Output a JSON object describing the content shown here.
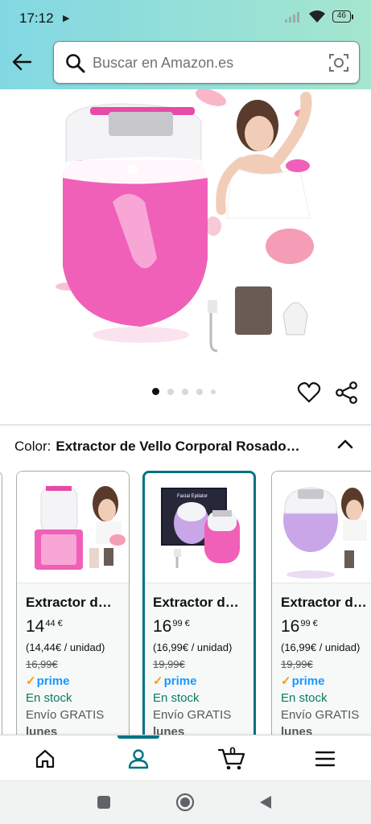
{
  "status_bar": {
    "time": "17:12",
    "battery": "46"
  },
  "search": {
    "placeholder": "Buscar en Amazon.es"
  },
  "gallery": {
    "image_count": 5,
    "active_index": 0
  },
  "color": {
    "label": "Color:",
    "value": "Extractor de Vello Corporal Rosado…"
  },
  "variants": [
    {
      "title": "Extractor d…",
      "price_whole": "14",
      "price_fraction": "44 €",
      "unit_price": "(14,44€ / unidad)",
      "list_price": "16,99€",
      "prime": "prime",
      "stock": "En stock",
      "shipping": "Envío GRATIS",
      "delivery": "lunes"
    },
    {
      "title": "Extractor d…",
      "price_whole": "16",
      "price_fraction": "99 €",
      "unit_price": "(16,99€ / unidad)",
      "list_price": "19,99€",
      "prime": "prime",
      "stock": "En stock",
      "shipping": "Envío GRATIS",
      "delivery": "lunes"
    },
    {
      "title": "Extractor d…",
      "price_whole": "16",
      "price_fraction": "99 €",
      "unit_price": "(16,99€ / unidad)",
      "list_price": "19,99€",
      "prime": "prime",
      "stock": "En stock",
      "shipping": "Envío GRATIS",
      "delivery": "lunes"
    }
  ],
  "product_box_text": "Facial Epilator",
  "bottom_nav": {
    "cart_count": "0"
  },
  "colors": {
    "header_start": "#82d8e3",
    "header_end": "#a5e6ce",
    "selected_border": "#007185",
    "prime_blue": "#1a98ff",
    "stock_green": "#067d62",
    "product_pink": "#f060b8"
  }
}
